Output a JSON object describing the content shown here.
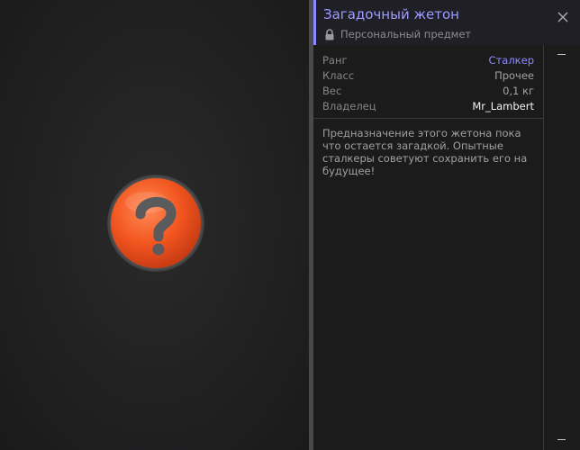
{
  "item": {
    "title": "Загадочный жетон",
    "subtitle": "Персональный предмет",
    "icon": "question-mark-token",
    "title_color": "#9f9bff",
    "accent_color": "#8b87ff"
  },
  "stats": [
    {
      "label": "Ранг",
      "value": "Сталкер"
    },
    {
      "label": "Класс",
      "value": "Прочее"
    },
    {
      "label": "Вес",
      "value": "0,1 кг"
    },
    {
      "label": "Владелец",
      "value": "Mr_Lambert"
    }
  ],
  "description": "Предназначение этого жетона пока что остается загадкой. Опытные сталкеры советуют сохранить его на будущее!"
}
